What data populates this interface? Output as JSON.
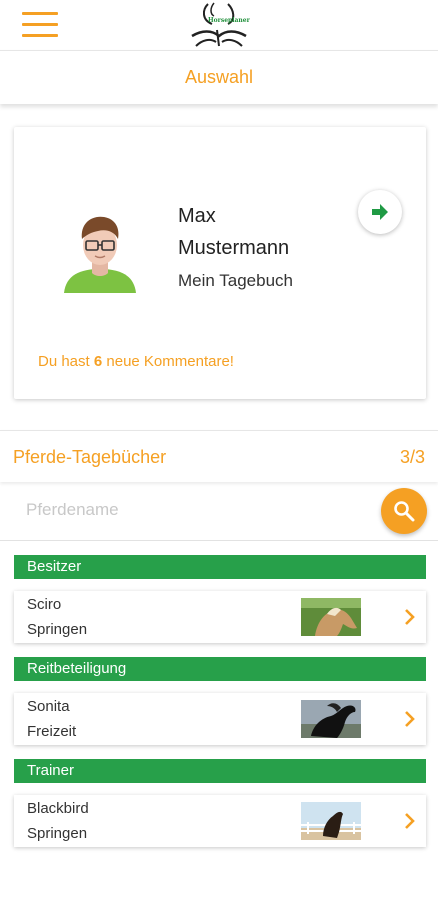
{
  "app": {
    "logo_text": "Horseplaner",
    "menu_icon": "hamburger-menu-icon"
  },
  "subheader": {
    "title": "Auswahl"
  },
  "profile": {
    "first_name": "Max",
    "last_name": "Mustermann",
    "diary_label": "Mein Tagebuch",
    "comments_prefix": "Du hast ",
    "comments_count": "6",
    "comments_suffix": " neue Kommentare!",
    "open_icon": "arrow-right-icon"
  },
  "horses_section": {
    "title": "Pferde-Tagebücher",
    "count": "3/3"
  },
  "search": {
    "placeholder": "Pferdename",
    "value": "",
    "icon": "search-icon"
  },
  "groups": [
    {
      "label": "Besitzer",
      "horse": {
        "name": "Sciro",
        "discipline": "Springen"
      }
    },
    {
      "label": "Reitbeteiligung",
      "horse": {
        "name": "Sonita",
        "discipline": "Freizeit"
      }
    },
    {
      "label": "Trainer",
      "horse": {
        "name": "Blackbird",
        "discipline": "Springen"
      }
    }
  ],
  "colors": {
    "accent_orange": "#f5a023",
    "group_green": "#27a04a",
    "arrow_green": "#1f9a44"
  }
}
